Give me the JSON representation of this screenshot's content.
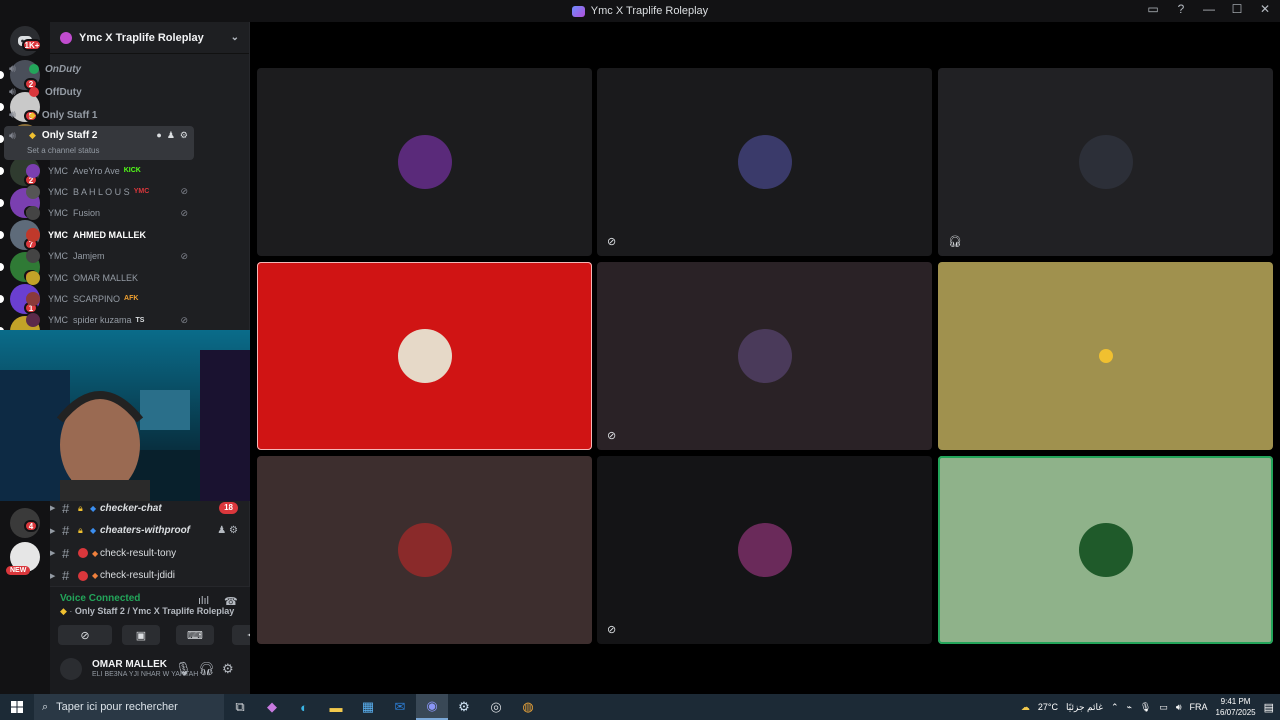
{
  "window": {
    "title": "Ymc X Traplife Roleplay"
  },
  "rail": {
    "home_badge": "1K+",
    "servers": [
      {
        "badge": "2",
        "color": "#4a4f5a"
      },
      {
        "badge": "5",
        "color": "#c9c9c9"
      },
      {
        "badge": "2",
        "color": "#8a6f3a"
      },
      {
        "badge": "2",
        "color": "#2f3b2f"
      },
      {
        "badge": "2",
        "color": "#7a3fb0"
      },
      {
        "badge": "7",
        "color": "#5e6b7a"
      },
      {
        "badge": "1",
        "color": "#2f7a35"
      },
      {
        "badge": "1",
        "color": "#6a3fd0"
      },
      {
        "badge": "",
        "color": "#c2a228"
      }
    ],
    "lower_badge": "4",
    "new_label": "NEW"
  },
  "sidebar": {
    "guild_name": "Ymc X Traplife Roleplay",
    "voice_channels": [
      {
        "name": "OnDuty",
        "dot": "#23a55a"
      },
      {
        "name": "OffDuty",
        "dot": "#da373c"
      },
      {
        "name": "Only Staff 1",
        "dot": ""
      },
      {
        "name": "Only Staff 2",
        "dot": "",
        "status": "Set a channel status"
      }
    ],
    "members": [
      {
        "tag": "YMC",
        "name": "AveYro Ave",
        "extra": "KICK",
        "av": "#7a3fb0"
      },
      {
        "tag": "YMC",
        "name": "B A H L O U S",
        "extra": "YMC",
        "av": "#555"
      },
      {
        "tag": "YMC",
        "name": "Fusion",
        "extra": "",
        "av": "#444"
      },
      {
        "tag": "YMC",
        "name": "AHMED MALLEK",
        "extra": "",
        "av": "#c0392b"
      },
      {
        "tag": "YMC",
        "name": "Jamjem",
        "extra": "",
        "av": "#444"
      },
      {
        "tag": "YMC",
        "name": "OMAR MALLEK",
        "extra": "",
        "av": "#c2a228"
      },
      {
        "tag": "YMC",
        "name": "SCARPINO",
        "extra": "AFK",
        "av": "#8a3a3a"
      },
      {
        "tag": "YMC",
        "name": "spider kuzama",
        "extra": "TS",
        "av": "#5a2a4a"
      }
    ],
    "text_channels": [
      {
        "name": "checker-chat",
        "count": "18"
      },
      {
        "name": "cheaters-withproof",
        "count": ""
      },
      {
        "name": "check-result-tony",
        "count": ""
      },
      {
        "name": "check-result-jdidi",
        "count": ""
      }
    ]
  },
  "voice": {
    "status": "Voice Connected",
    "location": "Only Staff 2 / Ymc X Traplife Roleplay"
  },
  "user": {
    "name": "OMAR MALLEK",
    "status": "ELI BE3NA YJI NHAR W YARTAH"
  },
  "stage": {
    "tiles": [
      {
        "bg": "#1c1c1e",
        "avatar": "#5a2a7a",
        "muted": false,
        "deaf": false
      },
      {
        "bg": "#1a1a1c",
        "avatar": "#3a3a6a",
        "muted": true,
        "deaf": false
      },
      {
        "bg": "#212124",
        "avatar": "#2c2f38",
        "muted": false,
        "deaf": true
      },
      {
        "bg": "#d01414",
        "avatar": "#e6d9c8",
        "muted": false,
        "deaf": false
      },
      {
        "bg": "#2a2226",
        "avatar": "#4a3a5a",
        "muted": true,
        "deaf": false
      },
      {
        "bg": "#a0914e",
        "avatar": "#a0914e",
        "muted": false,
        "deaf": false
      },
      {
        "bg": "#3d2e2e",
        "avatar": "#8a2a2a",
        "muted": false,
        "deaf": false
      },
      {
        "bg": "#141416",
        "avatar": "#6a2a5a",
        "muted": true,
        "deaf": false
      },
      {
        "bg": "#8fb28a",
        "avatar": "#1f5a2a",
        "muted": false,
        "deaf": false
      }
    ]
  },
  "taskbar": {
    "search_placeholder": "Taper ici pour rechercher",
    "weather": "27°C",
    "weather_text": "غائم جزئيًا",
    "lang": "FRA",
    "time": "9:41 PM",
    "date": "16/07/2025"
  }
}
